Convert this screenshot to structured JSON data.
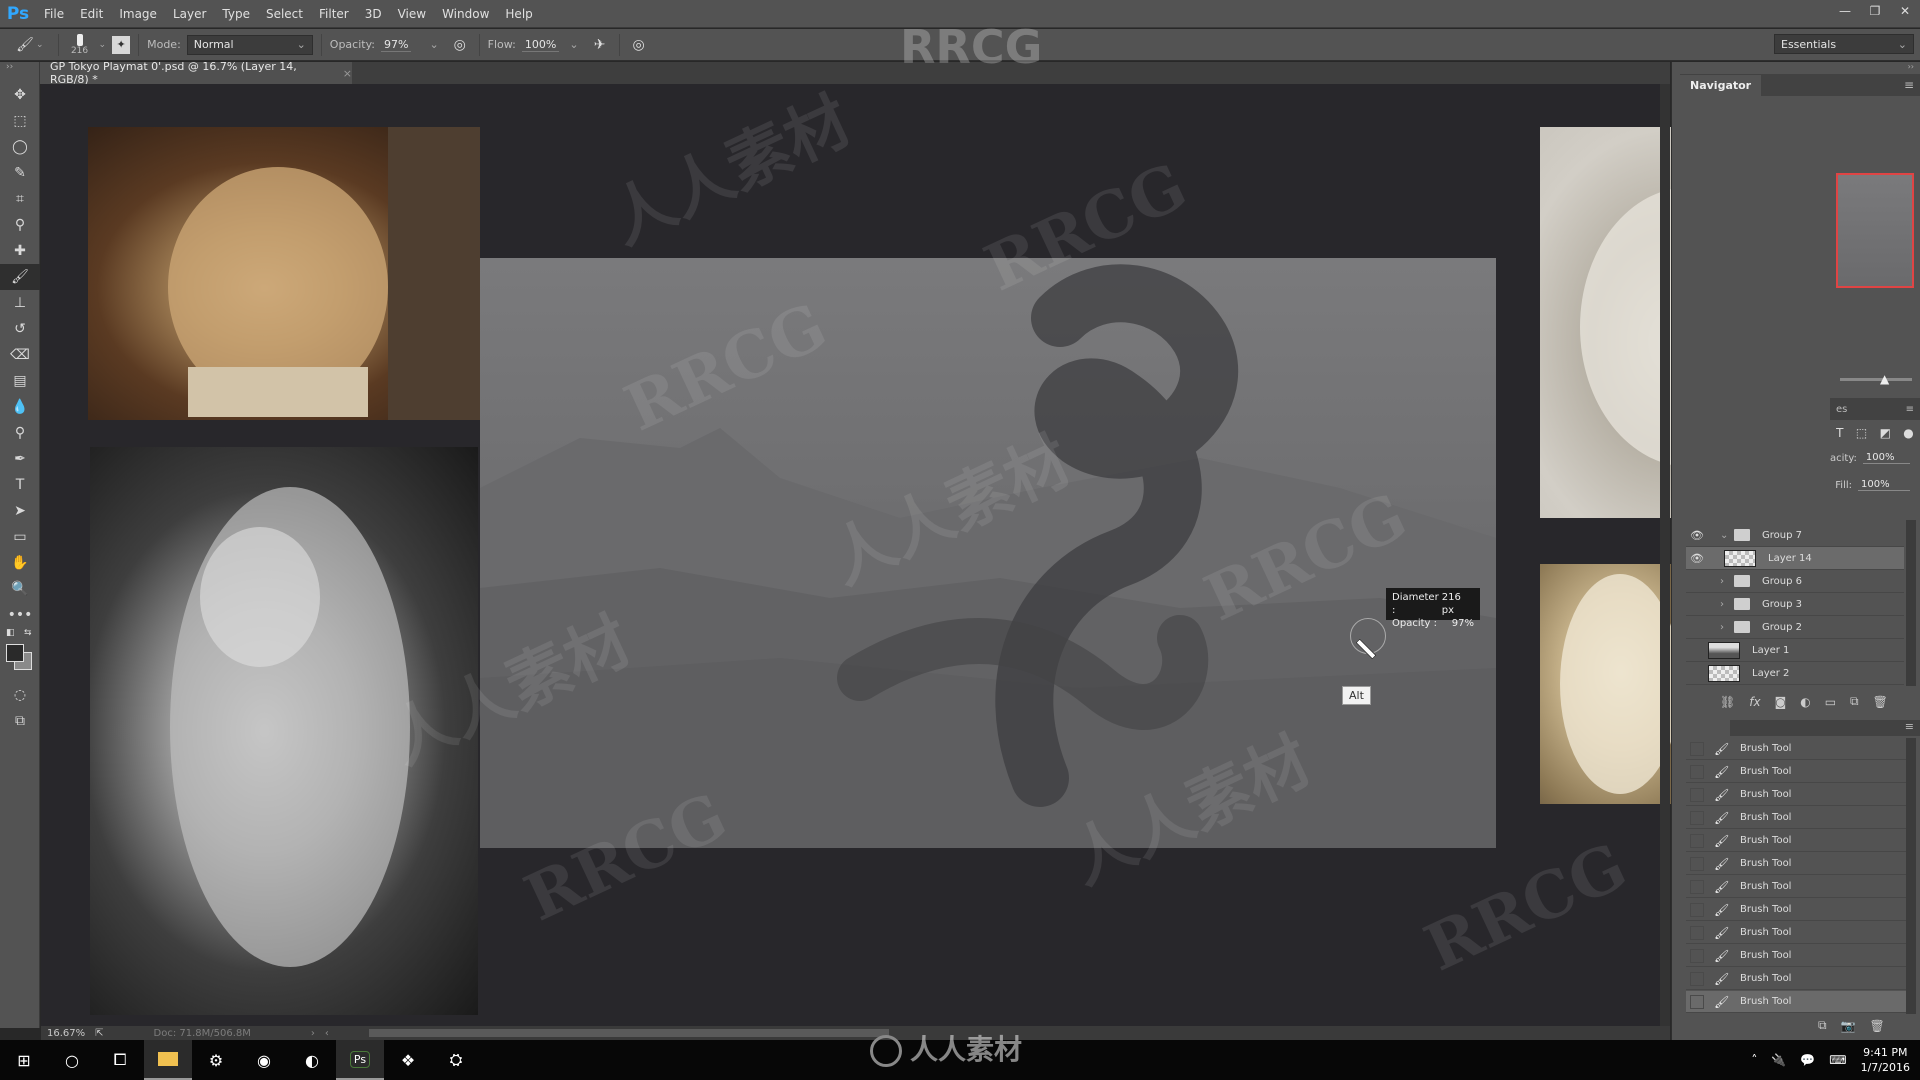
{
  "app": {
    "logo": "Ps",
    "menu": [
      "File",
      "Edit",
      "Image",
      "Layer",
      "Type",
      "Select",
      "Filter",
      "3D",
      "View",
      "Window",
      "Help"
    ],
    "window_controls": [
      "—",
      "❐",
      "✕"
    ]
  },
  "options_bar": {
    "brush_size": "216",
    "mode_label": "Mode:",
    "mode_value": "Normal",
    "opacity_label": "Opacity:",
    "opacity_value": "97%",
    "flow_label": "Flow:",
    "flow_value": "100%",
    "workspace": "Essentials"
  },
  "document": {
    "tab_title": "GP Tokyo Playmat 0'.psd @ 16.7% (Layer 14, RGB/8) *",
    "close": "×",
    "zoom": "16.67%",
    "doc_size": "Doc: 71.8M/506.8M"
  },
  "tools": [
    {
      "name": "move-tool",
      "glyph": "✥"
    },
    {
      "name": "marquee-tool",
      "glyph": "⬚"
    },
    {
      "name": "lasso-tool",
      "glyph": "◯"
    },
    {
      "name": "quick-select-tool",
      "glyph": "✎"
    },
    {
      "name": "crop-tool",
      "glyph": "⌗"
    },
    {
      "name": "eyedropper-tool",
      "glyph": "⚲"
    },
    {
      "name": "healing-brush-tool",
      "glyph": "✚"
    },
    {
      "name": "brush-tool",
      "glyph": "🖌",
      "active": true
    },
    {
      "name": "clone-stamp-tool",
      "glyph": "⊥"
    },
    {
      "name": "history-brush-tool",
      "glyph": "↺"
    },
    {
      "name": "eraser-tool",
      "glyph": "⌫"
    },
    {
      "name": "gradient-tool",
      "glyph": "▤"
    },
    {
      "name": "blur-tool",
      "glyph": "💧"
    },
    {
      "name": "dodge-tool",
      "glyph": "⚲"
    },
    {
      "name": "pen-tool",
      "glyph": "✒"
    },
    {
      "name": "type-tool",
      "glyph": "T"
    },
    {
      "name": "path-selection-tool",
      "glyph": "➤"
    },
    {
      "name": "rectangle-tool",
      "glyph": "▭"
    },
    {
      "name": "hand-tool",
      "glyph": "✋"
    },
    {
      "name": "zoom-tool",
      "glyph": "🔍"
    },
    {
      "name": "more-tools",
      "glyph": "•••"
    }
  ],
  "canvas": {
    "brush_hud": {
      "diameter_label": "Diameter :",
      "diameter_value": "216 px",
      "opacity_label": "Opacity :",
      "opacity_value": "97%"
    },
    "alt_key": "Alt",
    "watermarks": [
      "RRCG",
      "人人素材"
    ]
  },
  "navigator": {
    "title": "Navigator"
  },
  "layers": {
    "tab_fragment": "es",
    "opacity_label": "acity:",
    "opacity_value": "100%",
    "fill_label": "Fill:",
    "fill_value": "100%",
    "items": [
      {
        "name": "Group 7",
        "type": "group",
        "expanded": true,
        "visible": true
      },
      {
        "name": "Layer 14",
        "type": "layer",
        "visible": true,
        "selected": true
      },
      {
        "name": "Group 6",
        "type": "group",
        "expanded": false
      },
      {
        "name": "Group 3",
        "type": "group",
        "expanded": false
      },
      {
        "name": "Group 2",
        "type": "group",
        "expanded": false
      },
      {
        "name": "Layer 1",
        "type": "layer"
      },
      {
        "name": "Layer 2",
        "type": "layer"
      }
    ],
    "footer_icons": [
      "link",
      "fx",
      "mask",
      "adjustment",
      "folder",
      "new-layer",
      "trash"
    ]
  },
  "history": {
    "items": [
      "Brush Tool",
      "Brush Tool",
      "Brush Tool",
      "Brush Tool",
      "Brush Tool",
      "Brush Tool",
      "Brush Tool",
      "Brush Tool",
      "Brush Tool",
      "Brush Tool",
      "Brush Tool",
      "Brush Tool"
    ],
    "selected_index": 11
  },
  "taskbar": {
    "apps": [
      "start",
      "search",
      "task-view",
      "file-explorer",
      "mixer",
      "chrome",
      "firefox",
      "photoshop",
      "dropbox",
      "steam"
    ],
    "time": "9:41 PM",
    "date": "1/7/2016",
    "brand_overlay": "人人素材"
  }
}
